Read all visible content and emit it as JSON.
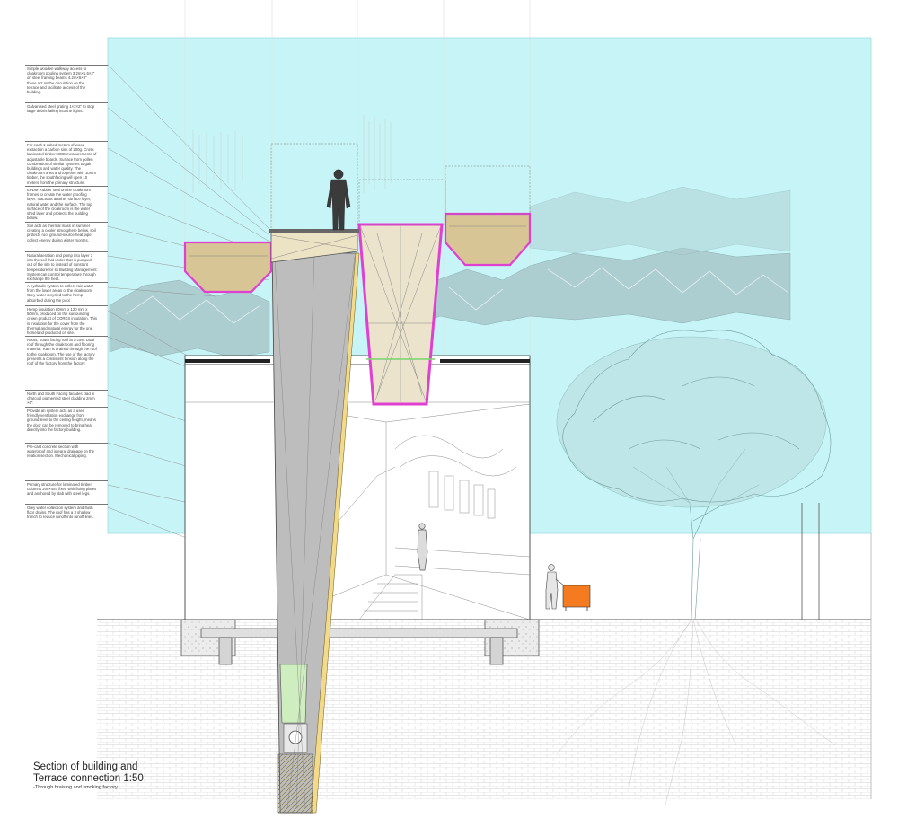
{
  "caption": {
    "title_line1": "Section of building and",
    "title_line2": "Terrace connection 1:50",
    "subtitle": "-Through braising and smoking factory"
  },
  "notes": [
    "Simple wooden walkway access to cloakroom pooling system 3.2m×1.6×2″ on steel framing beams 4.2m×6×2″ these act as the circulation on the terrace and facilitate access of the building.",
    "Galvanised steel grating 1×2×2″ to stop large debris falling into the lights.",
    "For each 1 cubed meters of wood extraction a carbon sink of 200g. Cross laminated timber: CEE measurements of adjustable boards. Surface from pollen combination of similar systems to gain buildings and water quality. The cloakroom area and together with 10mm timber, the southfacing will open 10 meters from the primary structure.",
    "EPDM Rubber seal on the cloakroom frames to create the water proofing layer. It acts as another surface layer, natural water and the surface. The top surface of the cloakroom is the water shed layer and protects the building below.",
    "Soil acts as thermal mass in summer creating a cooler atmosphere below, soil protects roof ground-source heat pipe collect energy during winter months.",
    "Natural aeration and pump into layer 3 into the soil that under that is pumped out of the site to instead of constant temperature for its Building Management System can control temperature through exchange the heat.",
    "A hydraulic system to collect rain water from the lower areas of the cloakroom. Grey water recycled to the hemp absorbed during the pool.",
    "Hemp insulation 80mm x 120 mm x 50mm, produced on the surrounding crown product of CORKS insulation. This is insulation for the cover from the thermal and natural energy for the one homeland produced on site.",
    "Roots, South facing roof at a cost. Dual roof through the cloakroom and flooring material. Rain is drained through the roof to the cloakroom. The use of the factory presents a consistent tension along the roof of the factory from the factory.",
    "North and South Facing facades clad in charcoal pigmented steel cladding 2mm ×6″.",
    "Provide an system acts as a user friendly ventilation exchange from ground level to the ceiling height, means the door can be removed to bring heat directly into the factory building.",
    "Pre-cast concrete section with waterproof and integral drainage on the relation section. Mechanical piping.",
    "Primary structure for laminated timber columns 200×487 fixed with fitting plates and anchored by slab with steel legs.",
    "Grey water collection system and flush floor drains. The roof has a 3 shallow trench to reduce runoff into runoff lines."
  ],
  "colors": {
    "sky": "#c7f5f7",
    "terrace_fill": "#d8c596",
    "membrane": "#e040d0",
    "column_grey": "#bdbdbd",
    "green_section": "#cfeec0",
    "pipe_yellow": "#f3d98a",
    "barrow": "#f47b20",
    "tree_line": "#6f9c9e",
    "ground_hatch": "#cfcfcf"
  }
}
